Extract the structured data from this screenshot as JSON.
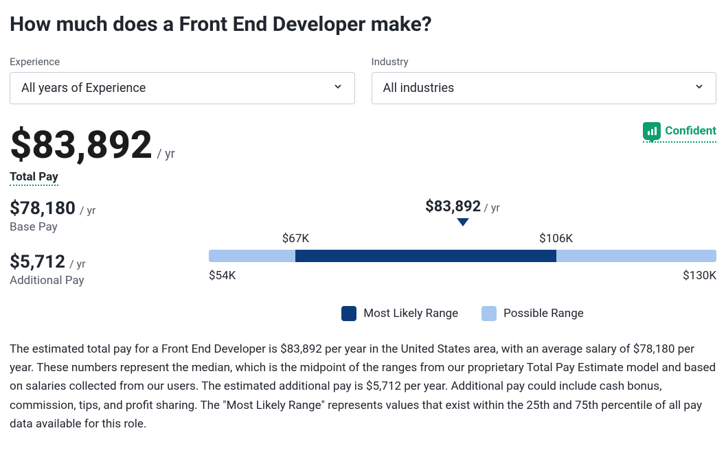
{
  "title": "How much does a Front End Developer make?",
  "filters": {
    "experience": {
      "label": "Experience",
      "selected": "All years of Experience"
    },
    "industry": {
      "label": "Industry",
      "selected": "All industries"
    }
  },
  "total_pay": {
    "amount": "$83,892",
    "per": "/ yr",
    "label": "Total Pay"
  },
  "confidence": "Confident",
  "base_pay": {
    "amount": "$78,180",
    "per": "/ yr",
    "label": "Base Pay"
  },
  "additional_pay": {
    "amount": "$5,712",
    "per": "/ yr",
    "label": "Additional Pay"
  },
  "chart_data": {
    "type": "bar",
    "pointer": {
      "amount": "$83,892",
      "per": "/ yr",
      "value": 83892
    },
    "possible_range": {
      "min": 54000,
      "max": 130000,
      "min_label": "$54K",
      "max_label": "$130K"
    },
    "likely_range": {
      "min": 67000,
      "max": 106000,
      "min_label": "$67K",
      "max_label": "$106K"
    },
    "legend": {
      "likely": "Most Likely Range",
      "possible": "Possible Range"
    }
  },
  "description": "The estimated total pay for a Front End Developer is $83,892 per year in the United States area, with an average salary of $78,180 per year. These numbers represent the median, which is the midpoint of the ranges from our proprietary Total Pay Estimate model and based on salaries collected from our users. The estimated additional pay is $5,712 per year. Additional pay could include cash bonus, commission, tips, and profit sharing. The \"Most Likely Range\" represents values that exist within the 25th and 75th percentile of all pay data available for this role."
}
